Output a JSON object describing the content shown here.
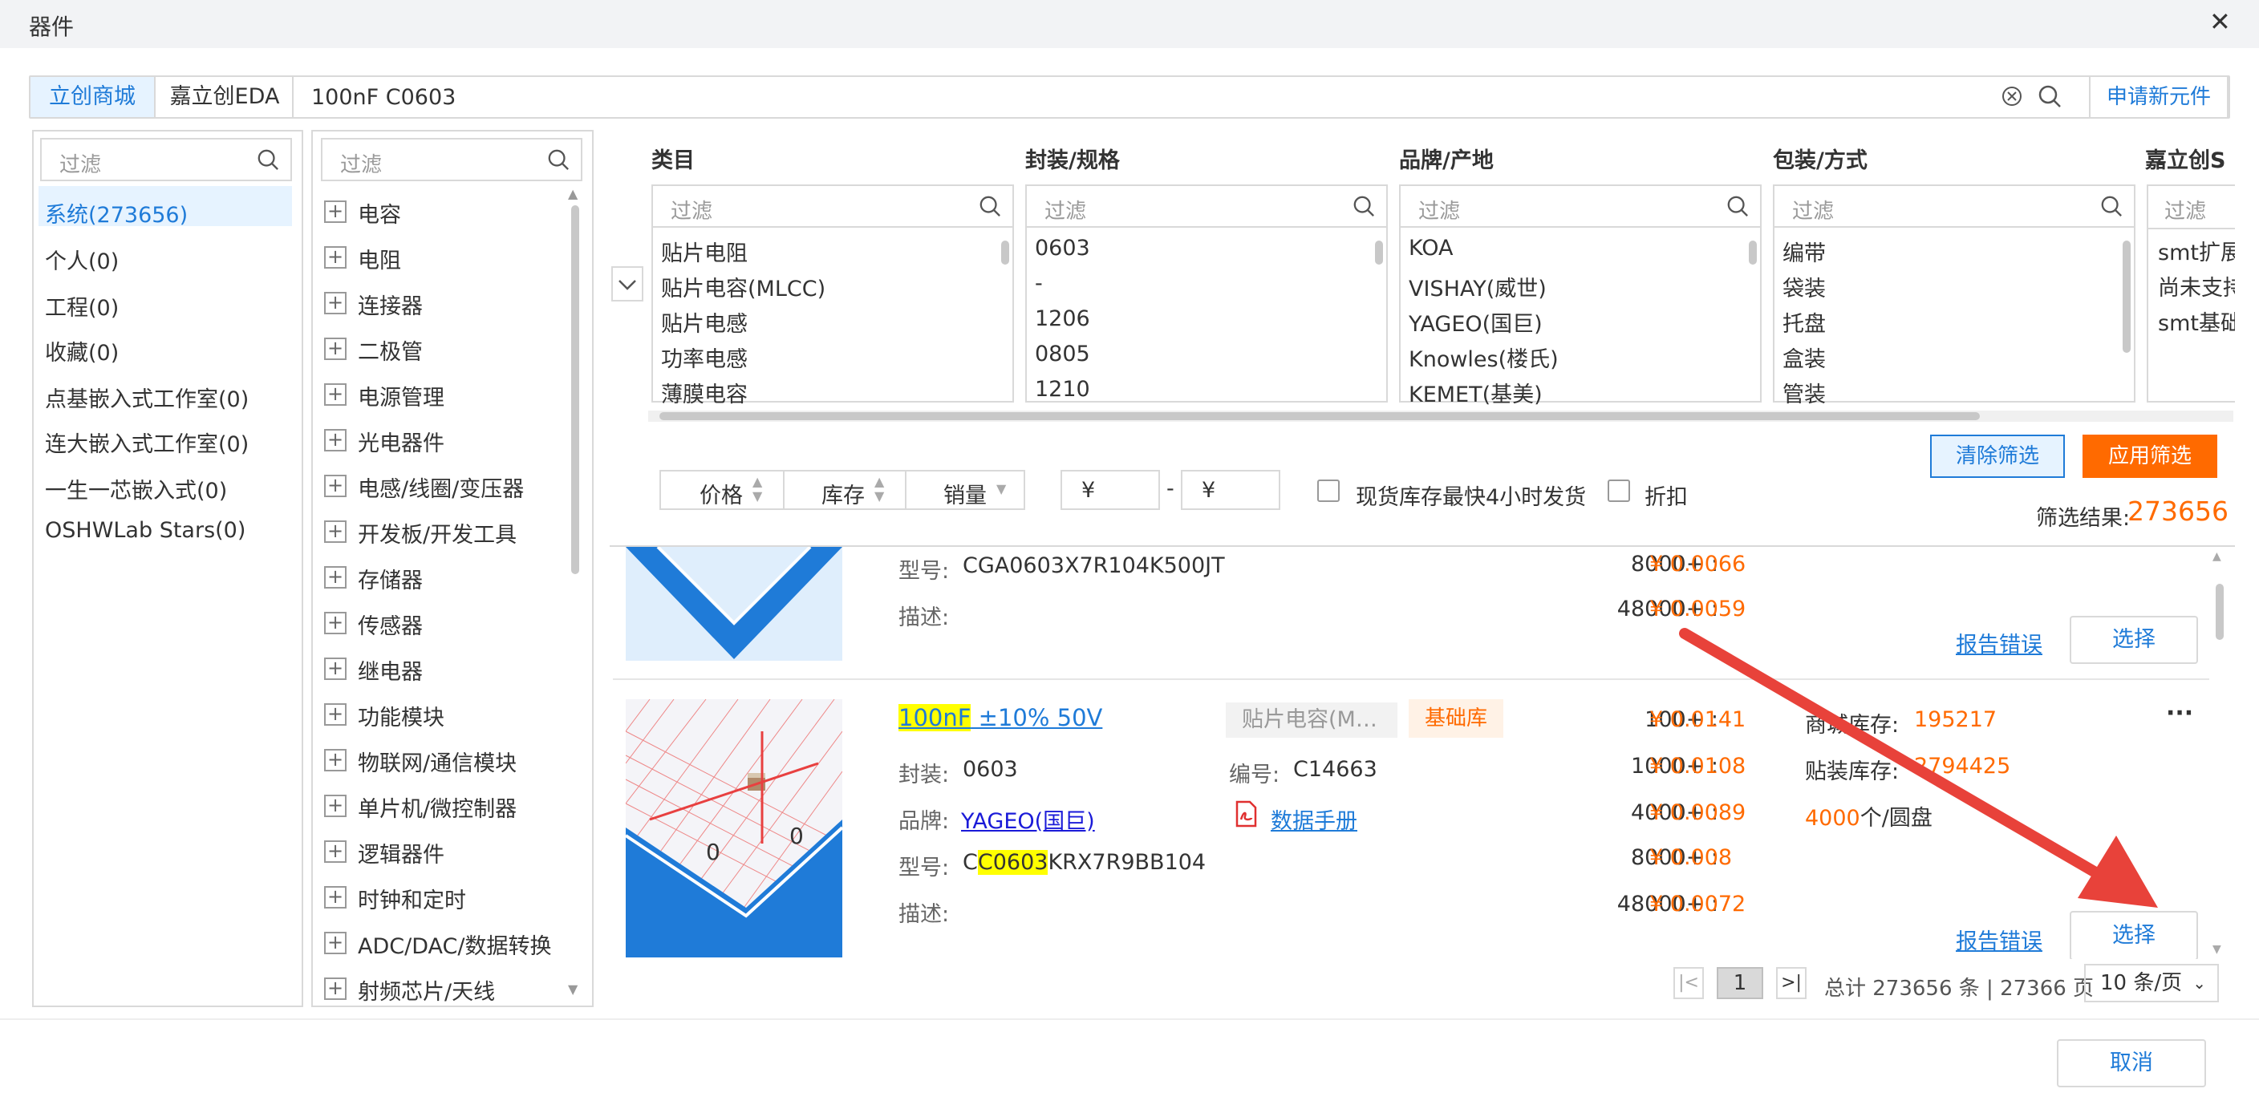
{
  "window": {
    "title": "器件",
    "close_glyph": "✕"
  },
  "search": {
    "source_tabs": [
      {
        "label": "立创商城",
        "active": true
      },
      {
        "label": "嘉立创EDA",
        "active": false
      }
    ],
    "query": "100nF C0603",
    "apply_new_label": "申请新元件"
  },
  "library": {
    "filter_placeholder": "过滤",
    "items": [
      "系统(273656)",
      "个人(0)",
      "工程(0)",
      "收藏(0)",
      "点基嵌入式工作室(0)",
      "连大嵌入式工作室(0)",
      "一生一芯嵌入式(0)",
      "OSHWLab Stars(0)"
    ],
    "selected": "系统(273656)"
  },
  "category_tree": {
    "filter_placeholder": "过滤",
    "items": [
      "电容",
      "电阻",
      "连接器",
      "二极管",
      "电源管理",
      "光电器件",
      "电感/线圈/变压器",
      "开发板/开发工具",
      "存储器",
      "传感器",
      "继电器",
      "功能模块",
      "物联网/通信模块",
      "单片机/微控制器",
      "逻辑器件",
      "时钟和定时",
      "ADC/DAC/数据转换",
      "射频芯片/天线"
    ]
  },
  "facets": [
    {
      "header": "类目",
      "placeholder": "过滤",
      "options": [
        "贴片电阻",
        "贴片电容(MLCC)",
        "贴片电感",
        "功率电感",
        "薄膜电容"
      ]
    },
    {
      "header": "封装/规格",
      "placeholder": "过滤",
      "options": [
        "0603",
        "-",
        "1206",
        "0805",
        "1210"
      ]
    },
    {
      "header": "品牌/产地",
      "placeholder": "过滤",
      "options": [
        "KOA",
        "VISHAY(威世)",
        "YAGEO(国巨)",
        "Knowles(楼氏)",
        "KEMET(基美)"
      ]
    },
    {
      "header": "包装/方式",
      "placeholder": "过滤",
      "options": [
        "编带",
        "袋装",
        "托盘",
        "盒装",
        "管装"
      ]
    },
    {
      "header": "嘉立创S",
      "placeholder": "过滤",
      "options": [
        "smt扩展",
        "尚未支持",
        "smt基础"
      ]
    }
  ],
  "filter_actions": {
    "clear": "清除筛选",
    "apply": "应用筛选",
    "result_label": "筛选结果:",
    "result_count": "273656"
  },
  "sort_bar": {
    "price": "价格",
    "stock": "库存",
    "sales": "销量",
    "currency": "¥",
    "dash": "-",
    "checkbox_stock": "现货库存最快4小时发货",
    "checkbox_discount": "折扣"
  },
  "results": [
    {
      "model_label": "型号:",
      "model": "CGA0603X7R104K500JT",
      "desc_label": "描述:",
      "prices": [
        {
          "qty": "8000+ :",
          "price": "¥ 0.0066"
        },
        {
          "qty": "48000+ :",
          "price": "¥ 0.0059"
        }
      ],
      "report": "报告错误",
      "select": "选择"
    },
    {
      "title_hl": "100nF",
      "title_rest": " ±10% 50V",
      "category": "贴片电容(M…",
      "lib_badge": "基础库",
      "package_label": "封装:",
      "package": "0603",
      "code_label": "编号:",
      "code": "C14663",
      "brand_label": "品牌:",
      "brand": "YAGEO(国巨)",
      "datasheet": "数据手册",
      "model_label": "型号:",
      "model_pre": "C",
      "model_hl": "C0603",
      "model_post": "KRX7R9BB104",
      "desc_label": "描述:",
      "prices": [
        {
          "qty": "100+ :",
          "price": "¥ 0.0141"
        },
        {
          "qty": "1000+ :",
          "price": "¥ 0.0108"
        },
        {
          "qty": "4000+ :",
          "price": "¥ 0.0089"
        },
        {
          "qty": "8000+ :",
          "price": "¥ 0.008"
        },
        {
          "qty": "48000+ :",
          "price": "¥ 0.0072"
        }
      ],
      "mall_stock_label": "商城库存:",
      "mall_stock": "195217",
      "smt_stock_label": "贴装库存:",
      "smt_stock": "2794425",
      "reel_qty": "4000",
      "reel_unit": "个/圆盘",
      "more": "···",
      "report": "报告错误",
      "select": "选择"
    }
  ],
  "pagination": {
    "first": "|<",
    "page": "1",
    "last": ">|",
    "total_text": "总计 273656 条 | 27366 页",
    "page_size": "10 条/页"
  },
  "footer": {
    "cancel": "取消"
  },
  "colors": {
    "accent_blue": "#1f7bd8",
    "accent_orange": "#ff6a00",
    "arrow_red": "#e8423a",
    "selected_bg": "#e6f3ff"
  }
}
